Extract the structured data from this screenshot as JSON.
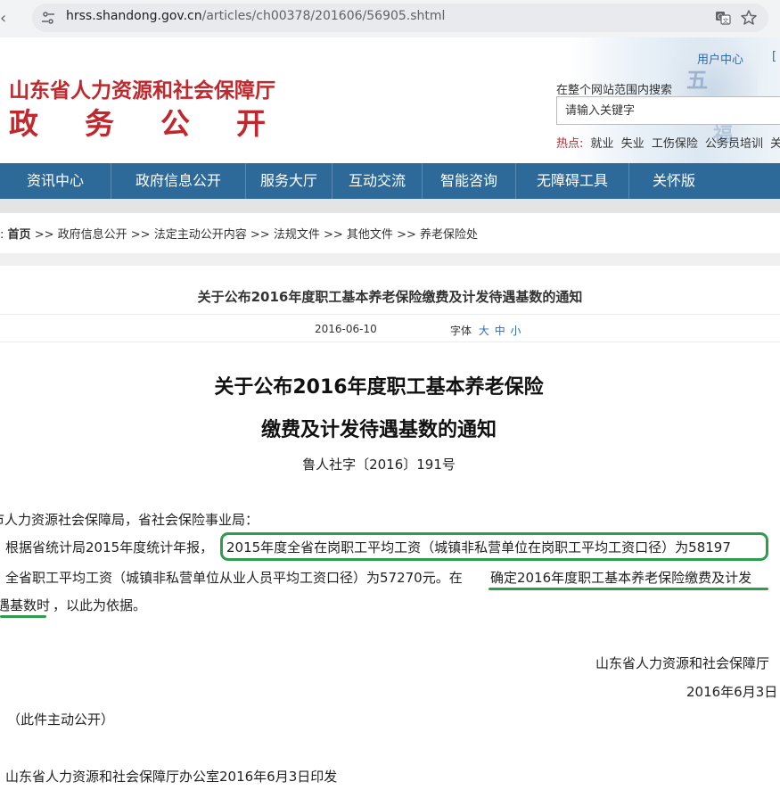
{
  "browser": {
    "url_host": "hrss.shandong.gov.cn",
    "url_path": "/articles/ch00378/201606/56905.shtml"
  },
  "header": {
    "title": "山东省人力资源和社会保障厅",
    "subtitle": "政务公开",
    "user_center": "用户中心",
    "user_bracket": "[",
    "search_scope": "在整个网站范围内搜索",
    "search_placeholder": "请输入关键字",
    "hot_label": "热点:",
    "hot_links": [
      "就业",
      "失业",
      "工伤保险",
      "公务员培训",
      "关"
    ],
    "deco_chars": [
      "五",
      "福"
    ]
  },
  "nav": {
    "items": [
      "资讯中心",
      "政府信息公开",
      "服务大厅",
      "互动交流",
      "智能咨询",
      "无障碍工具",
      "关怀版"
    ]
  },
  "breadcrumb": {
    "prefix": ":",
    "home": "首页",
    "items": [
      "政府信息公开",
      "法定主动公开内容",
      "法规文件",
      "其他文件",
      "养老保险处"
    ],
    "sep": ">>"
  },
  "article": {
    "top_title": "关于公布2016年度职工基本养老保险缴费及计发待遇基数的通知",
    "date": "2016-06-10",
    "font_label": "字体",
    "font_sizes": [
      "大",
      "中",
      "小"
    ],
    "doc_title_line1": "关于公布2016年度职工基本养老保险",
    "doc_title_line2": "缴费及计发待遇基数的通知",
    "doc_number": "鲁人社字〔2016〕191号",
    "salutation": "市人力资源社会保障局，省社会保险事业局：",
    "para1_a": "根据省统计局2015年度统计年报，",
    "para1_b": "2015年度全省在岗职工平均工资（城镇非私营单位在岗职工平均工资口径）为58197",
    "para2_a": "全省职工平均工资（城镇非私营单位从业人员平均工资口径）为57270元。在",
    "para2_b": "确定2016年度职工基本养老保险缴费及计发",
    "para3_a": "遇基数时",
    "para3_b": "，以此为依据。",
    "signature": "山东省人力资源和社会保障厅",
    "sign_date": "2016年6月3日",
    "disclosure": "（此件主动公开）",
    "issued": "山东省人力资源和社会保障厅办公室2016年6月3日印发"
  },
  "colors": {
    "brand_red": "#c0282d",
    "nav_blue": "#2e6a99",
    "link_blue": "#2d6db4",
    "highlight_green": "#2e9b4d"
  }
}
